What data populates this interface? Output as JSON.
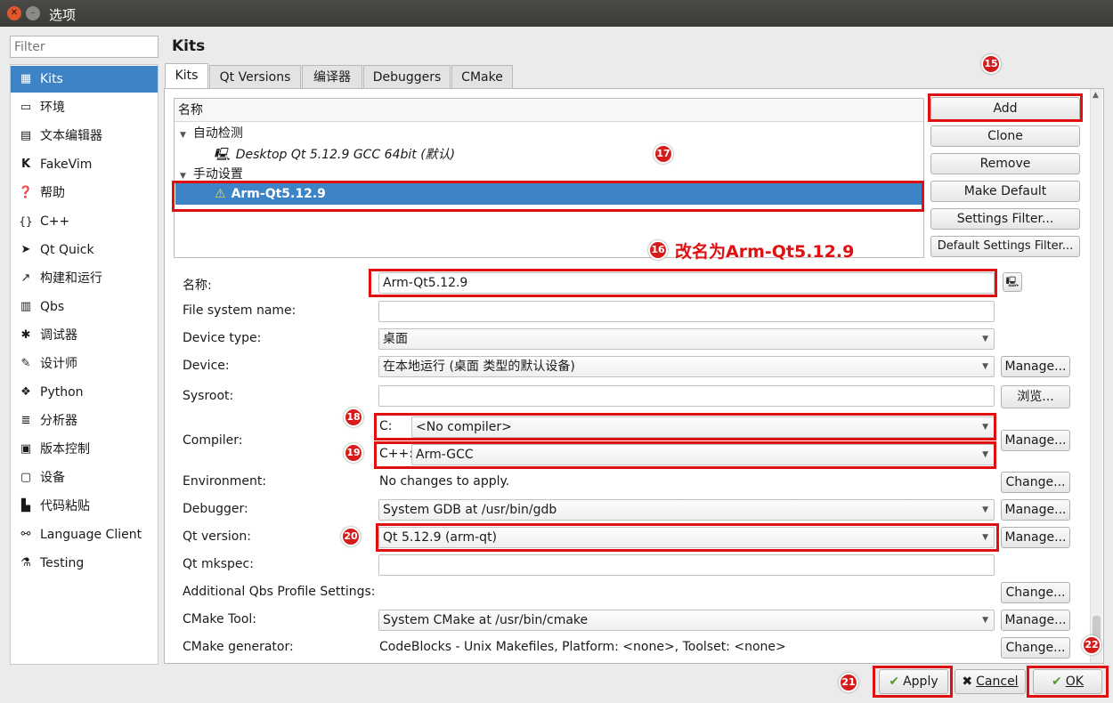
{
  "window": {
    "title": "选项"
  },
  "filter": {
    "placeholder": "Filter"
  },
  "sidebar": {
    "items": [
      {
        "label": "Kits",
        "icon": "kits-icon"
      },
      {
        "label": "环境",
        "icon": "monitor-icon"
      },
      {
        "label": "文本编辑器",
        "icon": "text-editor-icon"
      },
      {
        "label": "FakeVim",
        "icon": "fakevim-icon"
      },
      {
        "label": "帮助",
        "icon": "help-icon"
      },
      {
        "label": "C++",
        "icon": "braces-icon"
      },
      {
        "label": "Qt Quick",
        "icon": "qtquick-icon"
      },
      {
        "label": "构建和运行",
        "icon": "hammer-icon"
      },
      {
        "label": "Qbs",
        "icon": "qbs-icon"
      },
      {
        "label": "调试器",
        "icon": "bug-icon"
      },
      {
        "label": "设计师",
        "icon": "pen-icon"
      },
      {
        "label": "Python",
        "icon": "python-icon"
      },
      {
        "label": "分析器",
        "icon": "analyzer-icon"
      },
      {
        "label": "版本控制",
        "icon": "version-control-icon"
      },
      {
        "label": "设备",
        "icon": "device-icon"
      },
      {
        "label": "代码粘贴",
        "icon": "clipboard-icon"
      },
      {
        "label": "Language Client",
        "icon": "language-client-icon"
      },
      {
        "label": "Testing",
        "icon": "testing-icon"
      }
    ]
  },
  "main": {
    "heading": "Kits",
    "tabs": [
      "Kits",
      "Qt Versions",
      "编译器",
      "Debuggers",
      "CMake"
    ],
    "tree": {
      "header": "名称",
      "group_auto": "自动检测",
      "auto_kit": "Desktop Qt 5.12.9 GCC 64bit (默认)",
      "group_manual": "手动设置",
      "manual_kit": "Arm-Qt5.12.9"
    },
    "kit_buttons": [
      "Add",
      "Clone",
      "Remove",
      "Make Default",
      "Settings Filter...",
      "Default Settings Filter..."
    ],
    "form": {
      "name_label": "名称:",
      "name_value": "Arm-Qt5.12.9",
      "fs_label": "File system name:",
      "fs_value": "",
      "device_type_label": "Device type:",
      "device_type_value": "桌面",
      "device_label": "Device:",
      "device_value": "在本地运行 (桌面 类型的默认设备)",
      "device_manage": "Manage...",
      "sysroot_label": "Sysroot:",
      "sysroot_value": "",
      "sysroot_browse": "浏览...",
      "compiler_label": "Compiler:",
      "c_label": "C:",
      "c_value": "<No compiler>",
      "cpp_label": "C++:",
      "cpp_value": "Arm-GCC",
      "compiler_manage": "Manage...",
      "env_label": "Environment:",
      "env_value": "No changes to apply.",
      "env_change": "Change...",
      "debugger_label": "Debugger:",
      "debugger_value": "System GDB at /usr/bin/gdb",
      "debugger_manage": "Manage...",
      "qtver_label": "Qt version:",
      "qtver_value": "Qt 5.12.9 (arm-qt)",
      "qtver_manage": "Manage...",
      "mkspec_label": "Qt mkspec:",
      "mkspec_value": "",
      "qbs_label": "Additional Qbs Profile Settings:",
      "qbs_change": "Change...",
      "cmake_tool_label": "CMake Tool:",
      "cmake_tool_value": "System CMake at /usr/bin/cmake",
      "cmake_tool_manage": "Manage...",
      "cmake_gen_label": "CMake generator:",
      "cmake_gen_value": "CodeBlocks - Unix Makefiles, Platform: <none>, Toolset: <none>",
      "cmake_gen_change": "Change..."
    }
  },
  "footer": {
    "apply": "Apply",
    "cancel": "Cancel",
    "ok": "OK"
  },
  "annotations": {
    "b15": "15",
    "b16": "16",
    "b17": "17",
    "b18": "18",
    "b19": "19",
    "b20": "20",
    "b21": "21",
    "b22": "22",
    "rename_note": "改名为Arm-Qt5.12.9"
  },
  "colors": {
    "selection": "#3d84c6",
    "annotation": "#e01010"
  }
}
